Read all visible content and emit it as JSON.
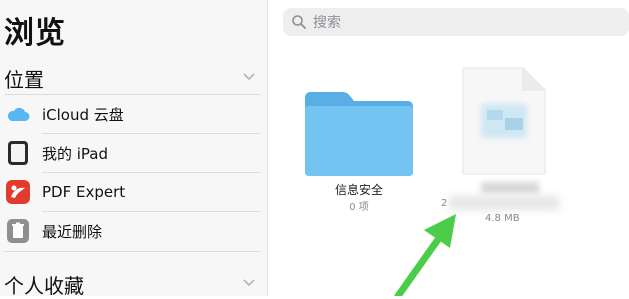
{
  "sidebar": {
    "title": "浏览",
    "sections": [
      {
        "header": "位置",
        "items": [
          {
            "label": "iCloud 云盘",
            "icon": "icloud-icon"
          },
          {
            "label": "我的 iPad",
            "icon": "ipad-icon"
          },
          {
            "label": "PDF Expert",
            "icon": "pdf-expert-icon"
          },
          {
            "label": "最近删除",
            "icon": "trash-icon"
          }
        ]
      },
      {
        "header": "个人收藏",
        "items": []
      }
    ]
  },
  "main": {
    "search": {
      "placeholder": "搜索"
    },
    "files": [
      {
        "name": "信息安全",
        "meta": "0 项",
        "type": "folder"
      },
      {
        "name": "",
        "meta_prefix": "2",
        "size": "4.8 MB",
        "type": "document"
      }
    ]
  },
  "colors": {
    "folder": "#6fc2ef",
    "arrow": "#4ccd4a",
    "pdf_expert": "#e23b2e",
    "icloud": "#58b6f3"
  }
}
